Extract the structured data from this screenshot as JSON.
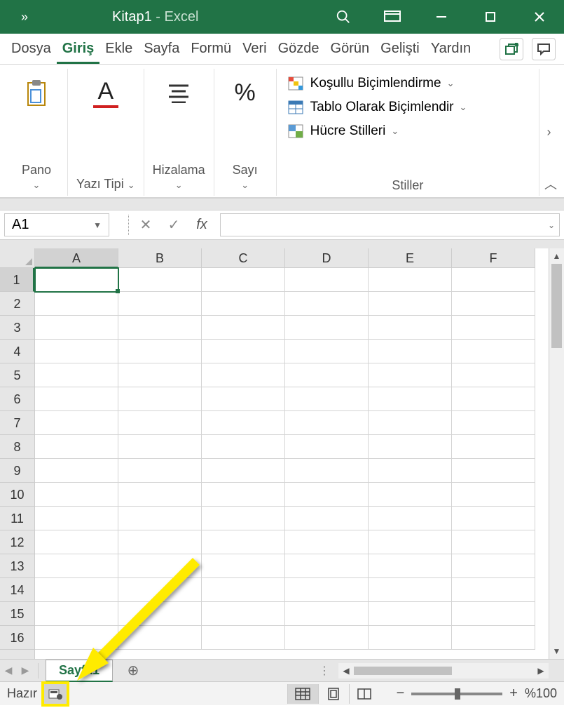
{
  "title": {
    "doc": "Kitap1",
    "sep": " - ",
    "app": "Excel"
  },
  "tabs": {
    "items": [
      "Dosya",
      "Giriş",
      "Ekle",
      "Sayfa",
      "Formü",
      "Veri",
      "Gözde",
      "Görün",
      "Gelişti",
      "Yardın"
    ],
    "active_index": 1
  },
  "ribbon": {
    "clipboard_label": "Pano",
    "font_label": "Yazı Tipi",
    "align_label": "Hizalama",
    "number_label": "Sayı",
    "percent_symbol": "%",
    "font_letter": "A",
    "styles": {
      "label": "Stiller",
      "conditional": "Koşullu Biçimlendirme",
      "table": "Tablo Olarak Biçimlendir",
      "cell": "Hücre Stilleri"
    }
  },
  "formula_bar": {
    "name_box": "A1",
    "fx": "fx",
    "formula": ""
  },
  "grid": {
    "columns": [
      "A",
      "B",
      "C",
      "D",
      "E",
      "F"
    ],
    "active_col": "A",
    "rows": [
      1,
      2,
      3,
      4,
      5,
      6,
      7,
      8,
      9,
      10,
      11,
      12,
      13,
      14,
      15,
      16
    ],
    "active_row": 1,
    "selected_cell": "A1"
  },
  "sheets": {
    "tab": "Sayfa1"
  },
  "status": {
    "ready": "Hazır",
    "zoom": "%100"
  }
}
